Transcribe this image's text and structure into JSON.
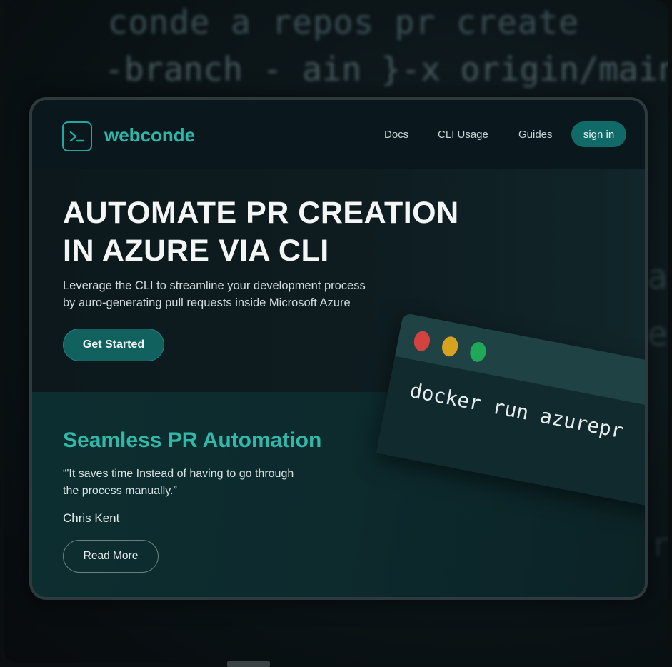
{
  "background_code": {
    "line1": "conde a repos pr create",
    "line2": "-branch - ain }-x origin/main br",
    "line3": "a",
    "line4": "e",
    "line5": "r"
  },
  "nav": {
    "brand": "webconde",
    "links": [
      "Docs",
      "CLI Usage",
      "Guides"
    ],
    "signin_label": "sign in",
    "logo_icon": "terminal-prompt-icon"
  },
  "hero": {
    "title_lines": [
      "AUTOMATE PR CREATION",
      "IN AZURE VIA CLI"
    ],
    "subtitle_lines": [
      "Leverage the CLI to streamline your development process",
      "by auro-generating pull requests inside Microsoft Azure"
    ],
    "cta_label": "Get Started"
  },
  "terminal": {
    "command": "docker run azurepr",
    "dot_colors": [
      "#d2423e",
      "#d7a21f",
      "#1fa85a"
    ]
  },
  "feature": {
    "title": "Seamless PR Automation",
    "quote_lines": [
      "“'It saves time Instead of having to go through",
      "the process manually.”"
    ],
    "author": "Chris Kent",
    "read_more_label": "Read More"
  },
  "colors": {
    "accent": "#2bb7a9",
    "button_bg": "#11615e",
    "page_bg": "#0a0f12"
  }
}
